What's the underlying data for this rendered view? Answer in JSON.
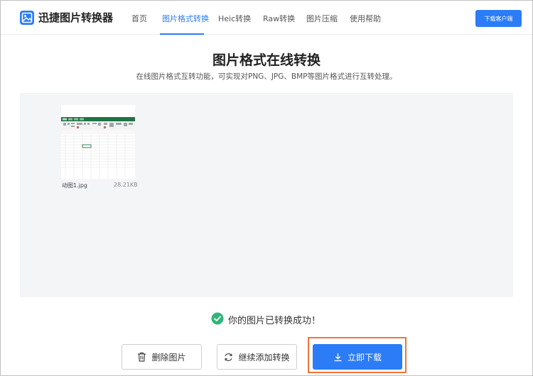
{
  "header": {
    "brand": "迅捷图片转换器",
    "nav": [
      {
        "label": "首页",
        "active": false
      },
      {
        "label": "图片格式转换",
        "active": true
      },
      {
        "label": "Heic转换",
        "active": false
      },
      {
        "label": "Raw转换",
        "active": false
      },
      {
        "label": "图片压缩",
        "active": false
      },
      {
        "label": "使用帮助",
        "active": false
      }
    ],
    "client_button": "下载客户端"
  },
  "page": {
    "title": "图片格式在线转换",
    "subtitle": "在线图片格式互转功能，可实现对PNG、JPG、BMP等图片格式进行互转处理。"
  },
  "file": {
    "name": "动图1.jpg",
    "size": "28.21KB",
    "thumbnail_icon": "spreadsheet-thumbnail"
  },
  "status": {
    "message": "你的图片已转换成功！",
    "icon": "check-circle-icon"
  },
  "actions": {
    "delete": "删除图片",
    "add": "继续添加转换",
    "download": "立即下载"
  },
  "colors": {
    "accent": "#2b7cf6",
    "success": "#2fb67a",
    "highlight": "#f0743a"
  }
}
